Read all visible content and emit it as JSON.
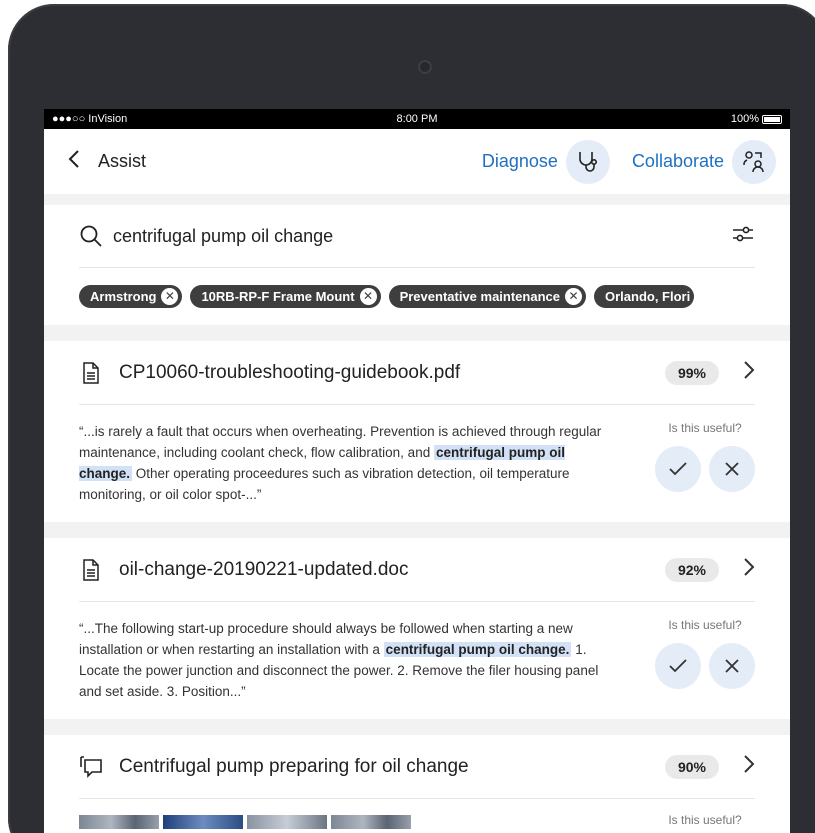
{
  "status": {
    "carrier": "●●●○○ InVision",
    "time": "8:00 PM",
    "battery": "100%"
  },
  "nav": {
    "title": "Assist",
    "diagnose_label": "Diagnose",
    "collaborate_label": "Collaborate"
  },
  "search": {
    "query": "centrifugal pump oil change",
    "chips": [
      "Armstrong",
      "10RB-RP-F Frame Mount",
      "Preventative maintenance",
      "Orlando, Flori"
    ]
  },
  "results": [
    {
      "file": "CP10060-troubleshooting-guidebook.pdf",
      "score": "99%",
      "snippet_before": "“...is rarely a fault that occurs when overheating. Prevention is achieved through regular maintenance, including coolant check, flow calibration, and ",
      "highlight": "centrifugal pump oil change.",
      "snippet_after": " Other operating proceedures such as vibration detection, oil temperature monitoring, or oil color spot-...”",
      "useful_label": "Is this useful?"
    },
    {
      "file": "oil-change-20190221-updated.doc",
      "score": "92%",
      "snippet_before": "“...The following start-up procedure should always be followed when starting a new installation or when restarting an installation with a ",
      "highlight": "centrifugal pump oil change.",
      "snippet_after": " 1. Locate the power junction and disconnect the power. 2. Remove the filer housing panel and set aside. 3. Position...”",
      "useful_label": "Is this useful?"
    },
    {
      "file": "Centrifugal pump preparing for oil change",
      "score": "90%",
      "useful_label": "Is this useful?"
    }
  ],
  "icons": {
    "back": "chevron-left-icon",
    "diagnose": "stethoscope-icon",
    "collaborate": "people-icon",
    "search": "search-icon",
    "filter": "sliders-icon",
    "document": "document-icon",
    "chat": "chat-icon",
    "accept": "check-icon",
    "reject": "close-icon"
  },
  "colors": {
    "accent": "#1f70c1",
    "highlight": "#d2e1f5",
    "chip": "#3e3e3e",
    "icon_circle": "#e4ecf7"
  }
}
